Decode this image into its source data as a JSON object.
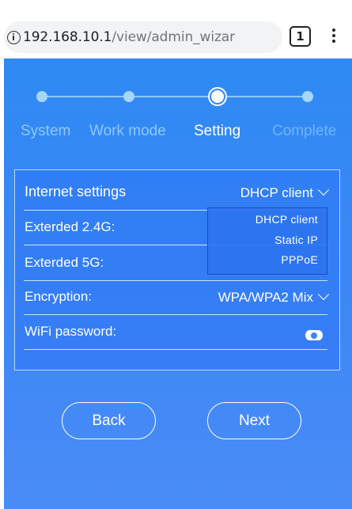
{
  "browser": {
    "url_host": "192.168.10.1",
    "url_path": "/view/admin_wizar",
    "tab_count": "1"
  },
  "wizard": {
    "steps": [
      {
        "label": "System",
        "state": "done"
      },
      {
        "label": "Work mode",
        "state": "done"
      },
      {
        "label": "Setting",
        "state": "current"
      },
      {
        "label": "Complete",
        "state": "pending"
      }
    ]
  },
  "settings": {
    "internet_label": "Internet settings",
    "internet_value": "DHCP  client",
    "extended_24_label": "Exterded 2.4G:",
    "extended_5_label": "Exterded 5G:",
    "encryption_label": "Encryption:",
    "encryption_value": "WPA/WPA2 Mix",
    "wifi_password_label": "WiFi password:",
    "wifi_password_value": "",
    "connection_options": [
      "DHCP  client",
      "Static  IP",
      "PPPoE"
    ]
  },
  "buttons": {
    "back": "Back",
    "next": "Next"
  },
  "colors": {
    "primary_blue": "#3b87f5",
    "text": "#ffffff",
    "inactive_step": "#8ec8fb"
  }
}
